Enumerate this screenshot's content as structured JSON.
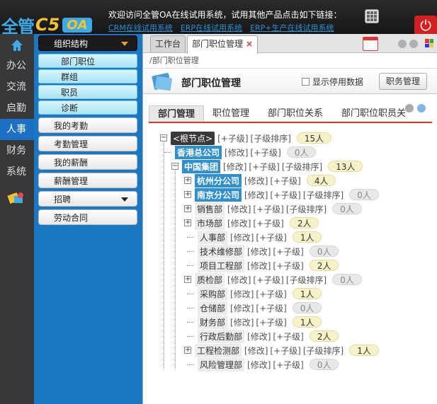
{
  "header": {
    "logo_part1": "全管",
    "logo_part2": "C5",
    "logo_part3": "OA",
    "welcome": "欢迎访问全管OA在线试用系统，试用其他产品点击如下链接：",
    "links": [
      "CRM在线试用系统",
      "ERP在线试用系统",
      "ERP+生产在线试用系统"
    ]
  },
  "leftnav": {
    "items": [
      {
        "label": "办公",
        "active": false
      },
      {
        "label": "交流",
        "active": false
      },
      {
        "label": "启勤",
        "active": false
      },
      {
        "label": "人事",
        "active": true
      },
      {
        "label": "财务",
        "active": false
      },
      {
        "label": "系统",
        "active": false
      }
    ]
  },
  "modules": {
    "org": "组织结构",
    "org_sub": [
      "部门职位",
      "群组",
      "职员",
      "诊断"
    ],
    "items": [
      "我的考勤",
      "考勤管理",
      "我的薪酬",
      "薪酬管理",
      "招聘",
      "劳动合同"
    ]
  },
  "tabs": {
    "workbench": "工作台",
    "current": "部门职位管理",
    "close": "×"
  },
  "breadcrumb": "/部门职位管理",
  "page": {
    "title": "部门职位管理",
    "show_disabled": "显示停用数据",
    "service_button": "职务管理"
  },
  "subtabs": [
    "部门管理",
    "职位管理",
    "部门职位关系",
    "部门职位职员关"
  ],
  "tree": {
    "root": {
      "label": "<根节点>",
      "ops": [
        "[+子级]",
        "[子级排序]"
      ],
      "count": "15人"
    },
    "nodes": [
      {
        "label": "香港总公司",
        "ops": [
          "[修改]",
          "[+子级]"
        ],
        "count": "0人"
      },
      {
        "label": "中国集团",
        "ops": [
          "[修改]",
          "[+子级]",
          "[子级排序]"
        ],
        "count": "13人"
      },
      {
        "label": "杭州分公司",
        "ops": [
          "[修改]",
          "[+子级]"
        ],
        "count": "4人"
      },
      {
        "label": "南京分公司",
        "ops": [
          "[修改]",
          "[+子级]",
          "[子级排序]"
        ],
        "count": "0人"
      },
      {
        "label": "销售部",
        "ops": [
          "[修改]",
          "[+子级]",
          "[子级排序]"
        ],
        "count": "0人"
      },
      {
        "label": "市场部",
        "ops": [
          "[修改]",
          "[+子级]"
        ],
        "count": "2人"
      },
      {
        "label": "人事部",
        "ops": [
          "[修改]",
          "[+子级]"
        ],
        "count": "1人"
      },
      {
        "label": "技术维修部",
        "ops": [
          "[修改]",
          "[+子级]"
        ],
        "count": "0人"
      },
      {
        "label": "项目工程部",
        "ops": [
          "[修改]",
          "[+子级]"
        ],
        "count": "2人"
      },
      {
        "label": "质检部",
        "ops": [
          "[修改]",
          "[+子级]",
          "[子级排序]"
        ],
        "count": "0人"
      },
      {
        "label": "采购部",
        "ops": [
          "[修改]",
          "[+子级]"
        ],
        "count": "1人"
      },
      {
        "label": "仓储部",
        "ops": [
          "[修改]",
          "[+子级]"
        ],
        "count": "0人"
      },
      {
        "label": "财务部",
        "ops": [
          "[修改]",
          "[+子级]"
        ],
        "count": "1人"
      },
      {
        "label": "行政后勤部",
        "ops": [
          "[修改]",
          "[+子级]"
        ],
        "count": "2人"
      },
      {
        "label": "工程检测部",
        "ops": [
          "[修改]",
          "[+子级]",
          "[子级排序]"
        ],
        "count": "1人"
      },
      {
        "label": "风险管理部",
        "ops": [
          "[修改]",
          "[+子级]"
        ],
        "count": "0人"
      }
    ]
  }
}
